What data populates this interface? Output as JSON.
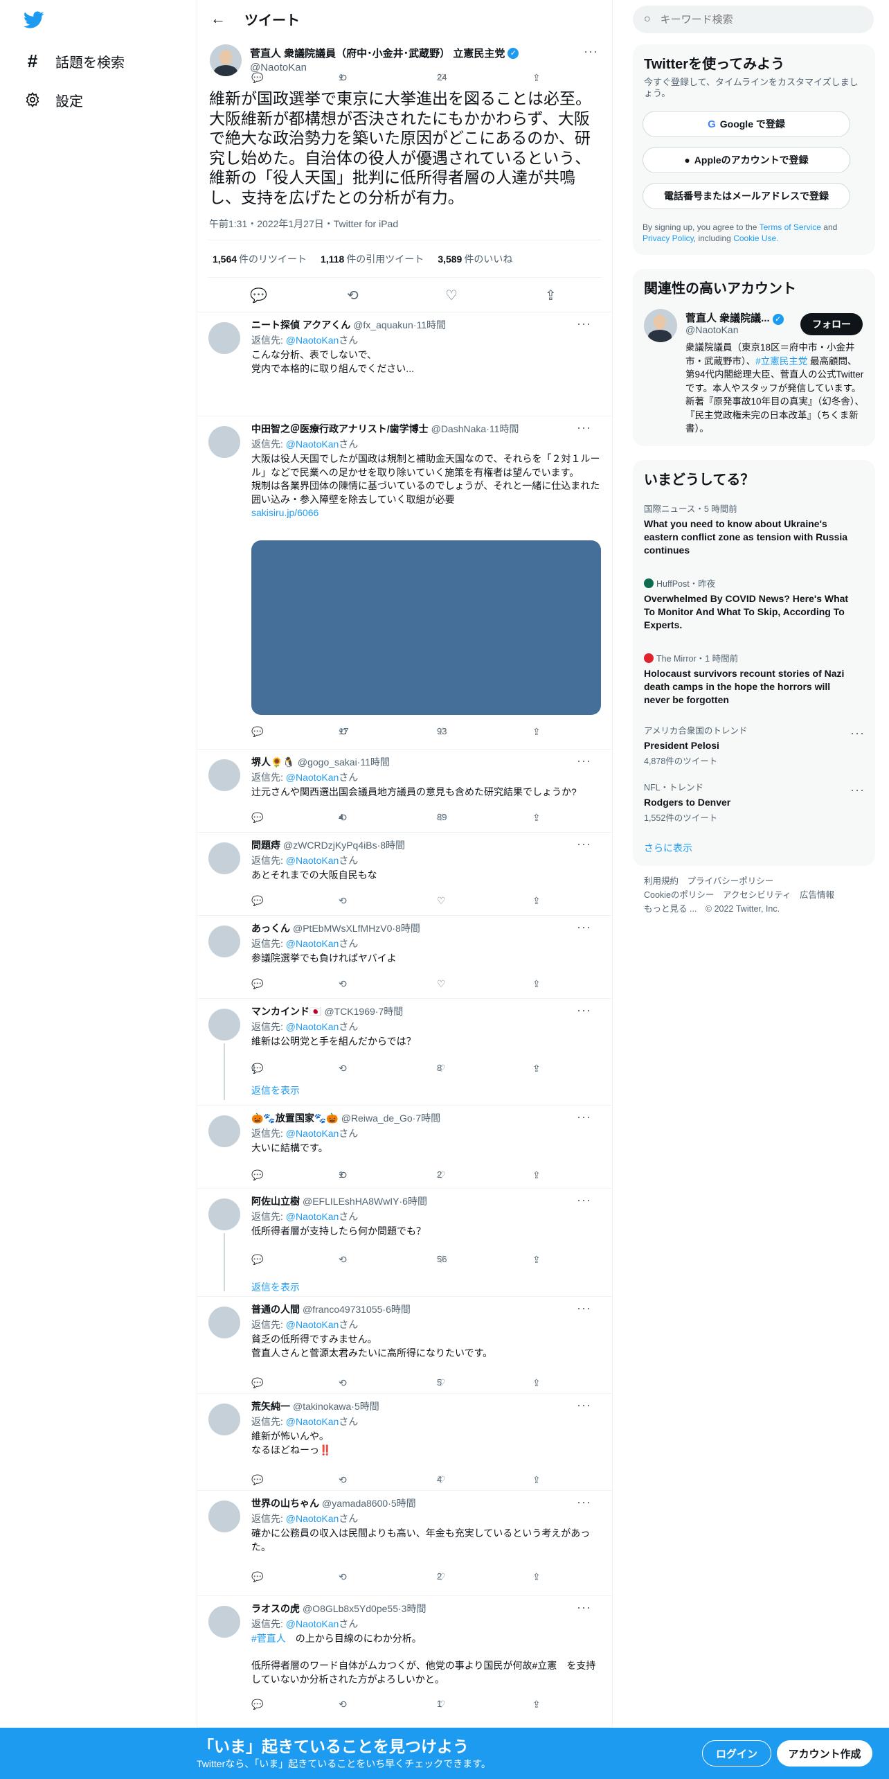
{
  "nav": {
    "explore_label": "話題を検索",
    "settings_label": "設定"
  },
  "header": {
    "title": "ツイート"
  },
  "main_tweet": {
    "name": "菅直人 衆議院議員（府中･小金井･武蔵野） 立憲民主党",
    "handle": "@NaotoKan",
    "text": "維新が国政選挙で東京に大挙進出を図ることは必至。大阪維新が都構想が否決されたにもかかわらず、大阪で絶大な政治勢力を築いた原因がどこにあるのか、研究し始めた。自治体の役人が優遇されているという、維新の「役人天国」批判に低所得者層の人達が共鳴し、支持を広げたとの分析が有力。",
    "meta": "午前1:31・2022年1月27日・Twitter for iPad",
    "retweets": "1,564",
    "retweets_label": "件のリツイート",
    "quotes": "1,118",
    "quotes_label": "件の引用ツイート",
    "likes": "3,589",
    "likes_label": "件のいいね"
  },
  "replies": [
    {
      "name": "ニート探偵 アクアくん",
      "handle": "@fx_aquakun",
      "time": "11時間",
      "to": "@NaotoKan",
      "san": "さん",
      "body": "こんな分析、表でしないで、\n党内で本格的に取り組んでください...",
      "retweets": "1",
      "likes": "24"
    },
    {
      "name": "中田智之＠医療行政アナリスト/歯学博士",
      "handle": "@DashNaka",
      "time": "11時間",
      "to": "@NaotoKan",
      "san": "さん",
      "body": "大阪は役人天国でしたが国政は規制と補助金天国なので、それらを「２対１ルール」などで民業への足かせを取り除いていく施策を有権者は望んでいます。\n規制は各業界団体の陳情に基づいているのでしょうが、それと一緒に仕込まれた囲い込み・参入障壁を除去していく取組が必要",
      "link": "sakisiru.jp/6066",
      "retweets": "17",
      "likes": "93"
    },
    {
      "name": "堺人🌻🐧",
      "handle": "@gogo_sakai",
      "time": "11時間",
      "to": "@NaotoKan",
      "san": "さん",
      "body": "辻元さんや関西選出国会議員地方議員の意見も含めた研究結果でしょうか?",
      "retweets": "4",
      "likes": "89"
    },
    {
      "name": "問題痔",
      "handle": "@zWCRDzjKyPq4iBs",
      "time": "8時間",
      "to": "@NaotoKan",
      "san": "さん",
      "body": "あとそれまでの大阪自民もな",
      "retweets": "",
      "likes": ""
    },
    {
      "name": "あっくん",
      "handle": "@PtEbMWsXLfMHzV0",
      "time": "8時間",
      "to": "@NaotoKan",
      "san": "さん",
      "body": "参議院選挙でも負ければヤバイよ",
      "retweets": "",
      "likes": ""
    },
    {
      "name": "マンカインド🇯🇵",
      "handle": "@TCK1969",
      "time": "7時間",
      "to": "@NaotoKan",
      "san": "さん",
      "body": "維新は公明党と手を組んだからでは？",
      "replies": "1",
      "retweets": "",
      "likes": "8",
      "show": "返信を表示"
    },
    {
      "name": "🎃🐾放置国家🐾🎃",
      "handle": "@Reiwa_de_Go",
      "time": "7時間",
      "to": "@NaotoKan",
      "san": "さん",
      "body": "大いに結構です。",
      "retweets": "1",
      "likes": "2"
    },
    {
      "name": "阿佐山立樹",
      "handle": "@EFLILEshHA8WwIY",
      "time": "6時間",
      "to": "@NaotoKan",
      "san": "さん",
      "body": "低所得者層が支持したら何か問題でも？",
      "retweets": "",
      "likes": "56",
      "show": "返信を表示"
    },
    {
      "name": "普通の人間",
      "handle": "@franco49731055",
      "time": "6時間",
      "to": "@NaotoKan",
      "san": "さん",
      "body": "貧乏の低所得ですみません。\n菅直人さんと菅源太君みたいに高所得になりたいです。",
      "retweets": "",
      "likes": "5"
    },
    {
      "name": "荒矢純一",
      "handle": "@takinokawa",
      "time": "5時間",
      "to": "@NaotoKan",
      "san": "さん",
      "body": "維新が怖いんや。\nなるほどねーっ‼️",
      "retweets": "",
      "likes": "4"
    },
    {
      "name": "世界の山ちゃん",
      "handle": "@yamada8600",
      "time": "5時間",
      "to": "@NaotoKan",
      "san": "さん",
      "body": "確かに公務員の収入は民間よりも高い、年金も充実しているという考えがあった。",
      "retweets": "",
      "likes": "2"
    },
    {
      "name": "ラオスの虎",
      "handle": "@O8GLb8x5Yd0pe55",
      "time": "3時間",
      "to": "@NaotoKan",
      "san": "さん",
      "tag": "#菅直人",
      "body": "　の上から目線のにわか分析。\n\n低所得者層のワード自体がムカつくが、他党の事より国民が何故#立憲　を支持していないか分析された方がよろしいかと。",
      "retweets": "",
      "likes": "1"
    }
  ],
  "right": {
    "search_placeholder": "キーワード検索",
    "signup_title": "Twitterを使ってみよう",
    "signup_sub": "今すぐ登録して、タイムラインをカスタマイズしましょう。",
    "google_btn": "Google で登録",
    "apple_btn": "Appleのアカウントで登録",
    "phone_btn": "電話番号またはメールアドレスで登録",
    "terms_pre": "By signing up, you agree to the",
    "terms_link": "Terms of Service",
    "terms_and": "and",
    "privacy_link": "Privacy Policy",
    "terms_inc": ", including",
    "cookie_link": "Cookie Use.",
    "related_title": "関連性の高いアカウント",
    "related_name": "菅直人 衆議院議...",
    "related_handle": "@NaotoKan",
    "follow_btn": "フォロー",
    "related_bio_1": "衆議院議員（東京18区＝府中市・小金井市・武蔵野市）、",
    "related_bio_tag": "#立憲民主党",
    "related_bio_2": " 最高顧問、第94代内閣総理大臣、菅直人の公式Twitterです。本人やスタッフが発信しています。新著『原発事故10年目の真実』（幻冬舎）、『民主党政権未完の日本改革』（ちくま新書）。",
    "trends_title": "いまどうしてる？",
    "trends": [
      {
        "cat": "国際ニュース・5 時間前",
        "title": "What you need to know about Ukraine's eastern conflict zone as tension with Russia continues"
      },
      {
        "cat": "HuffPost・昨夜",
        "title": "Overwhelmed By COVID News? Here's What To Monitor And What To Skip, According To Experts."
      },
      {
        "cat": "The Mirror・1 時間前",
        "title": "Holocaust survivors recount stories of Nazi death camps in the hope the horrors will never be forgotten"
      },
      {
        "cat": "アメリカ合衆国のトレンド",
        "title": "President Pelosi",
        "count": "4,878件のツイート"
      },
      {
        "cat": "NFL・トレンド",
        "title": "Rodgers to Denver",
        "count": "1,552件のツイート"
      }
    ],
    "show_more": "さらに表示",
    "footer_1": "利用規約　プライバシーポリシー",
    "footer_2": "Cookieのポリシー　アクセシビリティ　広告情報",
    "footer_3": "もっと見る ...　© 2022 Twitter, Inc."
  },
  "bottom": {
    "title": "「いま」起きていることを見つけよう",
    "sub": "Twitterなら、「いま」起きていることをいち早くチェックできます。",
    "login": "ログイン",
    "signup": "アカウント作成"
  },
  "colors": {
    "accent": "#1d9bf0",
    "banner": "#1d9bf0",
    "media": "#456f98"
  }
}
